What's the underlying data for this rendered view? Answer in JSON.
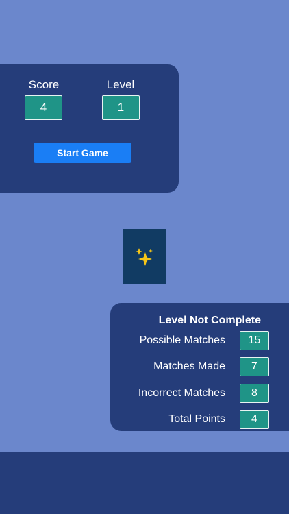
{
  "scoreboard": {
    "score_label": "Score",
    "score_value": "4",
    "level_label": "Level",
    "level_value": "1",
    "start_button": "Start Game"
  },
  "card": {
    "icon": "sparkles-icon"
  },
  "results": {
    "title": "Level Not Complete",
    "rows": [
      {
        "label": "Possible Matches",
        "value": "15"
      },
      {
        "label": "Matches Made",
        "value": "7"
      },
      {
        "label": "Incorrect Matches",
        "value": "8"
      },
      {
        "label": "Total Points",
        "value": "4"
      }
    ]
  },
  "colors": {
    "background": "#6b87cc",
    "panel": "#253d7a",
    "value_box": "#1f9487",
    "button": "#1a7ef5",
    "card": "#113b63",
    "sparkle": "#f5c518"
  }
}
